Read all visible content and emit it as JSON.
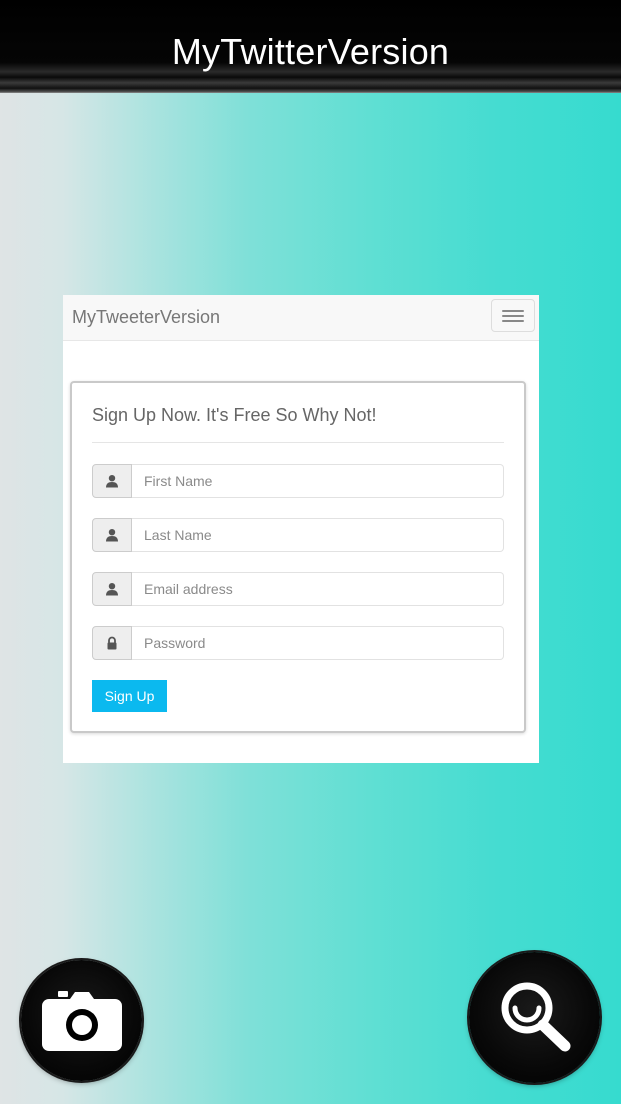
{
  "header": {
    "title": "MyTwitterVersion"
  },
  "navbar": {
    "brand": "MyTweeterVersion",
    "toggle_icon": "hamburger-menu-icon"
  },
  "signup_form": {
    "heading": "Sign Up Now. It's Free So Why Not!",
    "fields": [
      {
        "icon": "user-icon",
        "placeholder": "First Name",
        "value": ""
      },
      {
        "icon": "user-icon",
        "placeholder": "Last Name",
        "value": ""
      },
      {
        "icon": "user-icon",
        "placeholder": "Email address",
        "value": ""
      },
      {
        "icon": "lock-icon",
        "placeholder": "Password",
        "value": ""
      }
    ],
    "submit_label": "Sign Up"
  },
  "floating_buttons": {
    "left_icon": "camera-icon",
    "right_icon": "search-icon"
  },
  "colors": {
    "header_bg": "#000000",
    "accent_teal": "#36dbcf",
    "button_blue": "#0bb9ef",
    "navbar_bg": "#f8f8f8"
  }
}
